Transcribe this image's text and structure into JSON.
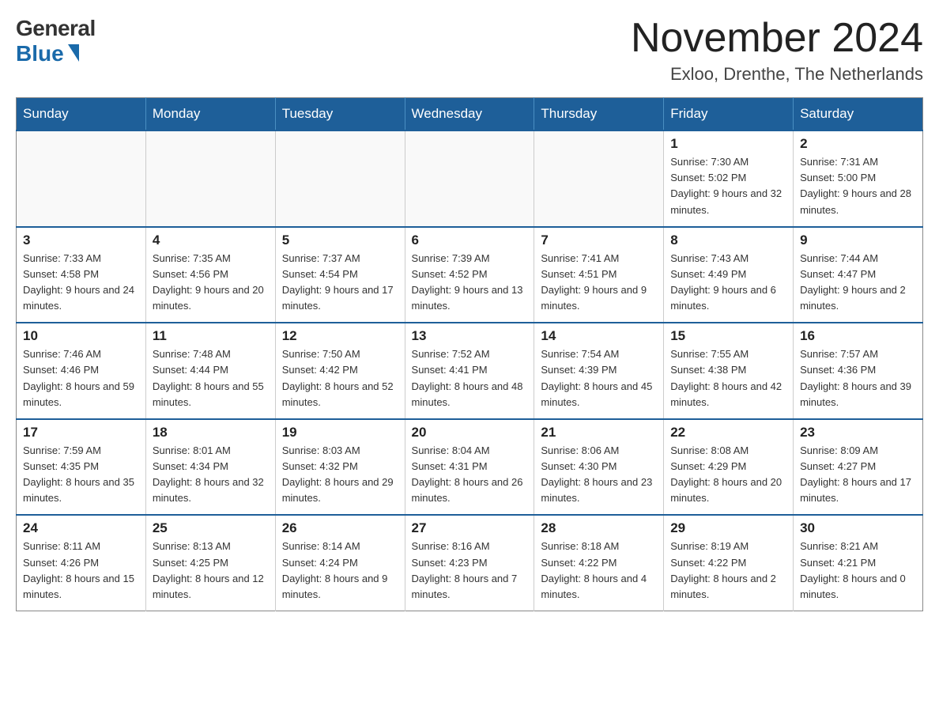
{
  "header": {
    "logo_general": "General",
    "logo_blue": "Blue",
    "month_title": "November 2024",
    "location": "Exloo, Drenthe, The Netherlands"
  },
  "days_of_week": [
    "Sunday",
    "Monday",
    "Tuesday",
    "Wednesday",
    "Thursday",
    "Friday",
    "Saturday"
  ],
  "weeks": [
    [
      {
        "day": "",
        "info": ""
      },
      {
        "day": "",
        "info": ""
      },
      {
        "day": "",
        "info": ""
      },
      {
        "day": "",
        "info": ""
      },
      {
        "day": "",
        "info": ""
      },
      {
        "day": "1",
        "info": "Sunrise: 7:30 AM\nSunset: 5:02 PM\nDaylight: 9 hours and 32 minutes."
      },
      {
        "day": "2",
        "info": "Sunrise: 7:31 AM\nSunset: 5:00 PM\nDaylight: 9 hours and 28 minutes."
      }
    ],
    [
      {
        "day": "3",
        "info": "Sunrise: 7:33 AM\nSunset: 4:58 PM\nDaylight: 9 hours and 24 minutes."
      },
      {
        "day": "4",
        "info": "Sunrise: 7:35 AM\nSunset: 4:56 PM\nDaylight: 9 hours and 20 minutes."
      },
      {
        "day": "5",
        "info": "Sunrise: 7:37 AM\nSunset: 4:54 PM\nDaylight: 9 hours and 17 minutes."
      },
      {
        "day": "6",
        "info": "Sunrise: 7:39 AM\nSunset: 4:52 PM\nDaylight: 9 hours and 13 minutes."
      },
      {
        "day": "7",
        "info": "Sunrise: 7:41 AM\nSunset: 4:51 PM\nDaylight: 9 hours and 9 minutes."
      },
      {
        "day": "8",
        "info": "Sunrise: 7:43 AM\nSunset: 4:49 PM\nDaylight: 9 hours and 6 minutes."
      },
      {
        "day": "9",
        "info": "Sunrise: 7:44 AM\nSunset: 4:47 PM\nDaylight: 9 hours and 2 minutes."
      }
    ],
    [
      {
        "day": "10",
        "info": "Sunrise: 7:46 AM\nSunset: 4:46 PM\nDaylight: 8 hours and 59 minutes."
      },
      {
        "day": "11",
        "info": "Sunrise: 7:48 AM\nSunset: 4:44 PM\nDaylight: 8 hours and 55 minutes."
      },
      {
        "day": "12",
        "info": "Sunrise: 7:50 AM\nSunset: 4:42 PM\nDaylight: 8 hours and 52 minutes."
      },
      {
        "day": "13",
        "info": "Sunrise: 7:52 AM\nSunset: 4:41 PM\nDaylight: 8 hours and 48 minutes."
      },
      {
        "day": "14",
        "info": "Sunrise: 7:54 AM\nSunset: 4:39 PM\nDaylight: 8 hours and 45 minutes."
      },
      {
        "day": "15",
        "info": "Sunrise: 7:55 AM\nSunset: 4:38 PM\nDaylight: 8 hours and 42 minutes."
      },
      {
        "day": "16",
        "info": "Sunrise: 7:57 AM\nSunset: 4:36 PM\nDaylight: 8 hours and 39 minutes."
      }
    ],
    [
      {
        "day": "17",
        "info": "Sunrise: 7:59 AM\nSunset: 4:35 PM\nDaylight: 8 hours and 35 minutes."
      },
      {
        "day": "18",
        "info": "Sunrise: 8:01 AM\nSunset: 4:34 PM\nDaylight: 8 hours and 32 minutes."
      },
      {
        "day": "19",
        "info": "Sunrise: 8:03 AM\nSunset: 4:32 PM\nDaylight: 8 hours and 29 minutes."
      },
      {
        "day": "20",
        "info": "Sunrise: 8:04 AM\nSunset: 4:31 PM\nDaylight: 8 hours and 26 minutes."
      },
      {
        "day": "21",
        "info": "Sunrise: 8:06 AM\nSunset: 4:30 PM\nDaylight: 8 hours and 23 minutes."
      },
      {
        "day": "22",
        "info": "Sunrise: 8:08 AM\nSunset: 4:29 PM\nDaylight: 8 hours and 20 minutes."
      },
      {
        "day": "23",
        "info": "Sunrise: 8:09 AM\nSunset: 4:27 PM\nDaylight: 8 hours and 17 minutes."
      }
    ],
    [
      {
        "day": "24",
        "info": "Sunrise: 8:11 AM\nSunset: 4:26 PM\nDaylight: 8 hours and 15 minutes."
      },
      {
        "day": "25",
        "info": "Sunrise: 8:13 AM\nSunset: 4:25 PM\nDaylight: 8 hours and 12 minutes."
      },
      {
        "day": "26",
        "info": "Sunrise: 8:14 AM\nSunset: 4:24 PM\nDaylight: 8 hours and 9 minutes."
      },
      {
        "day": "27",
        "info": "Sunrise: 8:16 AM\nSunset: 4:23 PM\nDaylight: 8 hours and 7 minutes."
      },
      {
        "day": "28",
        "info": "Sunrise: 8:18 AM\nSunset: 4:22 PM\nDaylight: 8 hours and 4 minutes."
      },
      {
        "day": "29",
        "info": "Sunrise: 8:19 AM\nSunset: 4:22 PM\nDaylight: 8 hours and 2 minutes."
      },
      {
        "day": "30",
        "info": "Sunrise: 8:21 AM\nSunset: 4:21 PM\nDaylight: 8 hours and 0 minutes."
      }
    ]
  ]
}
